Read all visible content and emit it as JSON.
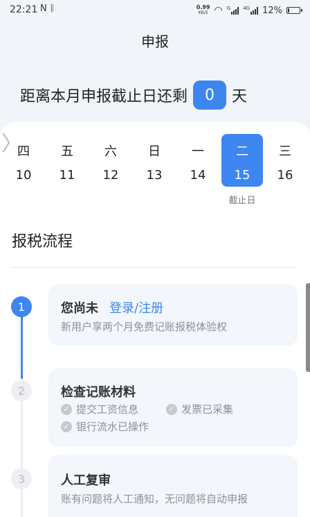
{
  "status_bar": {
    "time": "22:21",
    "left_icons": [
      "nfc-icon",
      "bluetooth-icon"
    ],
    "net_speed": "0.99",
    "net_unit": "KB/S",
    "signal_1_label": "G",
    "signal_2_label": "4G",
    "battery": "12%"
  },
  "header": {
    "title": "申报"
  },
  "countdown": {
    "prefix": "距离本月申报截止日还剩",
    "days": "0",
    "suffix": "天"
  },
  "calendar": {
    "days": [
      {
        "weekday": "四",
        "date": "10"
      },
      {
        "weekday": "五",
        "date": "11"
      },
      {
        "weekday": "六",
        "date": "12"
      },
      {
        "weekday": "日",
        "date": "13"
      },
      {
        "weekday": "一",
        "date": "14"
      },
      {
        "weekday": "二",
        "date": "15",
        "selected": true
      },
      {
        "weekday": "三",
        "date": "16"
      }
    ],
    "deadline_label": "截止日"
  },
  "process": {
    "title": "报税流程",
    "steps": [
      {
        "number": "1",
        "title": "您尚未",
        "link": "登录/注册",
        "desc": "新用户享两个月免费记账报税体验权"
      },
      {
        "number": "2",
        "title": "检查记账材料",
        "checks": [
          "提交工资信息",
          "发票已采集",
          "银行流水已操作"
        ]
      },
      {
        "number": "3",
        "title": "人工复审",
        "desc": "账有问题将人工通知，无问题将自动申报"
      }
    ]
  },
  "colors": {
    "accent": "#3d86f0",
    "background": "#f1f4f8",
    "muted": "#8d9097"
  }
}
